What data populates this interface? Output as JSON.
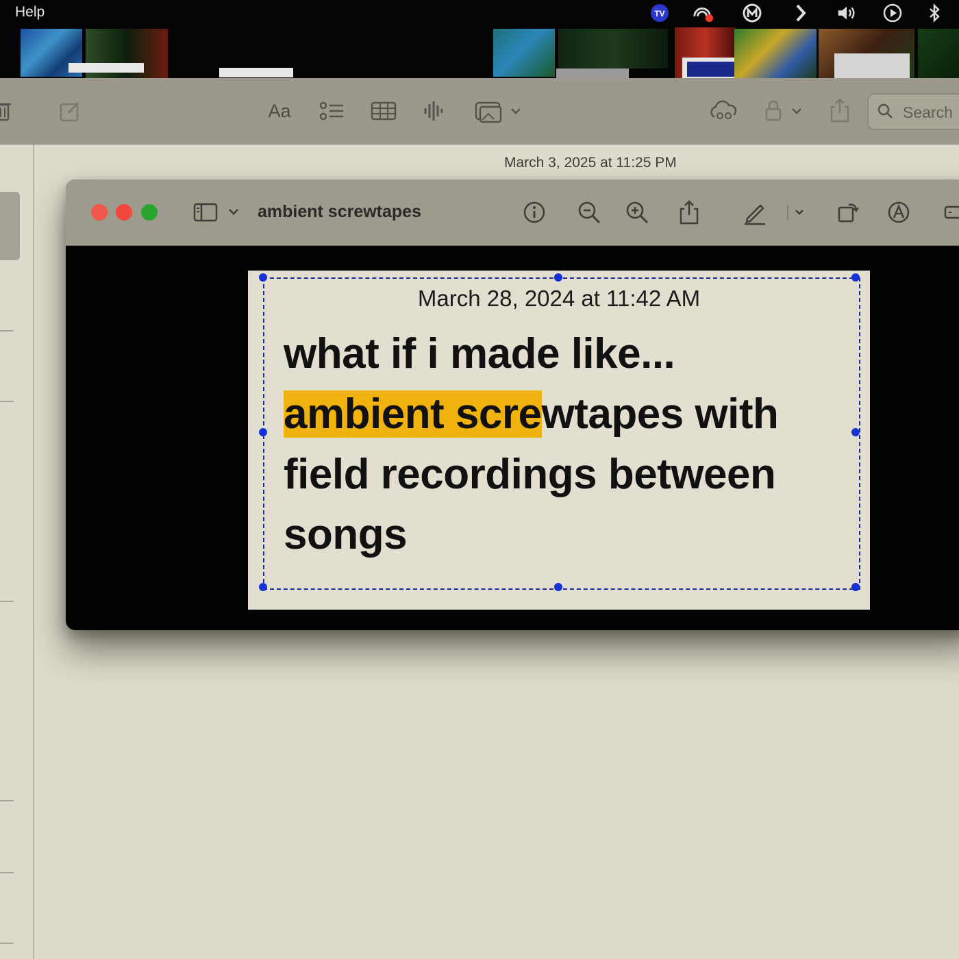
{
  "menu_bar": {
    "help_label": "Help",
    "status_icons": [
      "tv-icon",
      "cast-icon",
      "m-icon",
      "chevron-right-icon",
      "volume-icon",
      "play-icon",
      "bluetooth-icon"
    ]
  },
  "notes": {
    "toolbar": {
      "format_label": "Aa",
      "search_placeholder": "Search"
    },
    "note_date": "March 3, 2025 at 11:25 PM"
  },
  "preview": {
    "window_title": "ambient screwtapes",
    "document": {
      "date": "March 28, 2024 at 11:42 AM",
      "line1": "what if i made like...",
      "line2_highlighted": "ambient scre",
      "line2_rest": "wtapes with",
      "line3": "field recordings between",
      "line4": "songs"
    }
  },
  "colors": {
    "highlight": "#f0b20f",
    "selection_handle": "#1733d8",
    "close": "#f1574a",
    "minimize": "#f2473c",
    "zoom": "#2aa52d"
  }
}
